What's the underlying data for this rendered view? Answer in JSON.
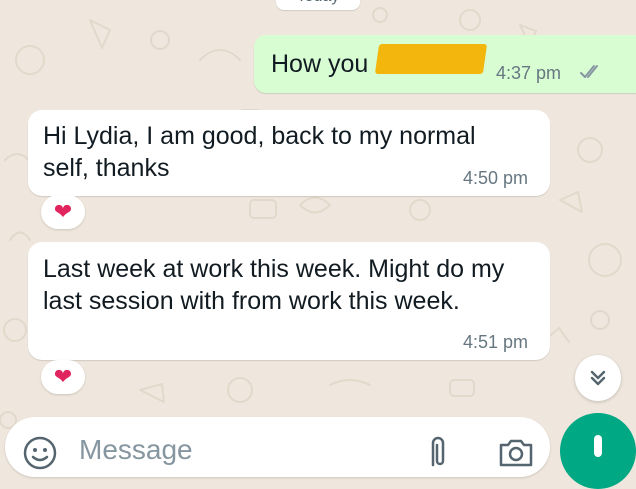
{
  "date_divider": "Today",
  "messages": [
    {
      "direction": "outgoing",
      "text": "How you",
      "time": "4:37 pm",
      "status_icon": "double-check-icon"
    },
    {
      "direction": "incoming",
      "text": "Hi Lydia, I am good, back to my normal self, thanks",
      "time": "4:50 pm",
      "reaction": "❤"
    },
    {
      "direction": "incoming",
      "text": "Last week at work this week. Might do my last session with from work this week.",
      "time": "4:51 pm",
      "reaction": "❤"
    }
  ],
  "composer": {
    "placeholder": "Message"
  },
  "colors": {
    "outgoing_bubble": "#d9fdd3",
    "incoming_bubble": "#ffffff",
    "wallpaper": "#efe7dd",
    "accent": "#00a884",
    "redaction": "#f2b60c"
  }
}
